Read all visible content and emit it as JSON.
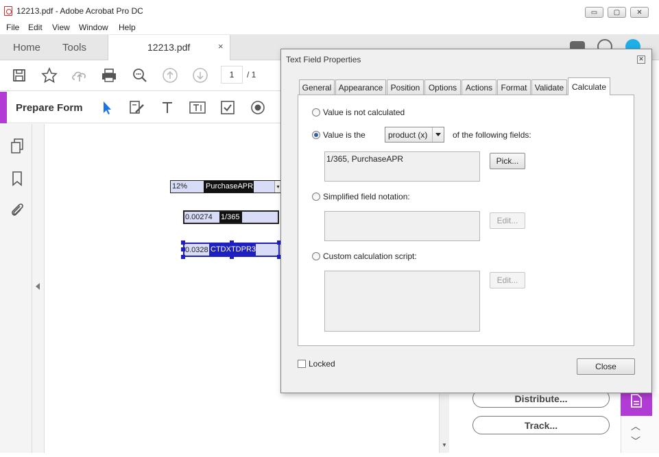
{
  "window": {
    "title": "12213.pdf - Adobe Acrobat Pro DC",
    "controls": {
      "minimize": "▭",
      "restore": "▢",
      "close": "✕"
    }
  },
  "menu": [
    "File",
    "Edit",
    "View",
    "Window",
    "Help"
  ],
  "tabs": {
    "home": "Home",
    "tools": "Tools",
    "document": "12213.pdf",
    "close_glyph": "×"
  },
  "toolbar": {
    "page_current": "1",
    "page_total": "/ 1"
  },
  "prepare_form": {
    "label": "Prepare Form"
  },
  "form_fields": {
    "apr_value": "12%",
    "apr_name": "PurchaseAPR",
    "daily_value": "0.00274",
    "daily_name": "1/365",
    "dpr_value": "0.0328",
    "dpr_name": "CTDXTDPR3"
  },
  "right_panel": {
    "distribute": "Distribute...",
    "track": "Track..."
  },
  "dialog": {
    "title": "Text Field Properties",
    "close_glyph": "✕",
    "tabs": [
      "General",
      "Appearance",
      "Position",
      "Options",
      "Actions",
      "Format",
      "Validate",
      "Calculate"
    ],
    "active_tab": "Calculate",
    "calc": {
      "not_calculated": "Value is not calculated",
      "value_is_the": "Value is the",
      "operation": "product (x)",
      "of_fields": "of the following fields:",
      "fields_value": "1/365, PurchaseAPR",
      "pick": "Pick...",
      "simplified": "Simplified field notation:",
      "custom": "Custom calculation script:",
      "edit": "Edit...",
      "selected_option": "Value is the"
    },
    "locked": "Locked",
    "close_button": "Close"
  },
  "colors": {
    "accent": "#b23bd6",
    "selection_blue": "#1f1fbf",
    "field_fill": "#d8dcf6",
    "toolbar_icon": "#555555",
    "arrow_blue": "#1a73e8",
    "profile": "#1eaee8"
  }
}
